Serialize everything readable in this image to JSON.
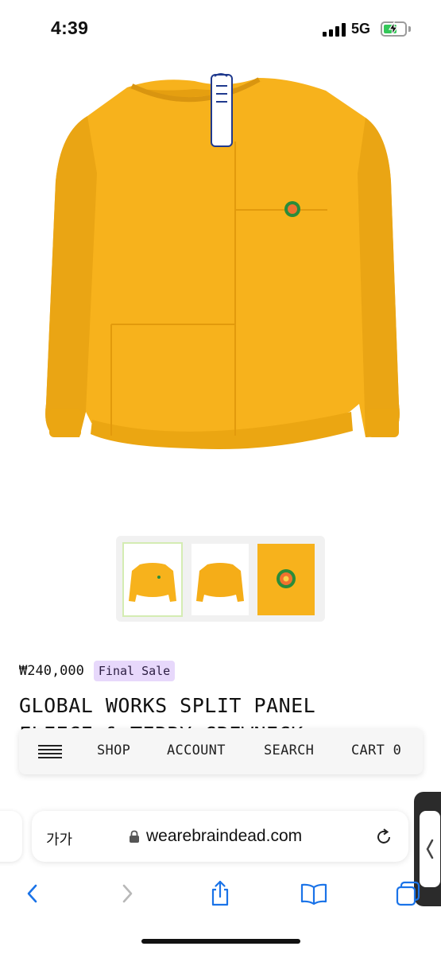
{
  "status_bar": {
    "time": "4:39",
    "network": "5G",
    "battery_charging": true,
    "battery_level": 0.55
  },
  "product": {
    "image_icon": "yellow-sweatshirt-image",
    "thumbnails": [
      {
        "name": "front",
        "active": true
      },
      {
        "name": "back",
        "active": false
      },
      {
        "name": "patch-detail",
        "active": false
      }
    ],
    "price": "₩240,000",
    "badge": "Final Sale",
    "title_line1": "GLOBAL WORKS SPLIT PANEL",
    "title_line2": "FLEECE & TERRY CREWNECK"
  },
  "nav": {
    "menu_icon": "hamburger-icon",
    "shop": "SHOP",
    "account": "ACCOUNT",
    "search": "SEARCH",
    "cart": "CART 0"
  },
  "safari": {
    "aa_label": "가가",
    "url": "wearebraindead.com",
    "lock_icon": "lock-icon",
    "reload_icon": "reload-icon"
  },
  "toolbar": {
    "icons": [
      "back-icon",
      "forward-icon",
      "share-icon",
      "bookmarks-icon",
      "tabs-icon"
    ]
  },
  "colors": {
    "sweatshirt": "#f7b21c",
    "badge_bg": "#e7d8fb",
    "safari_blue": "#1a73e8",
    "battery_green": "#34c759"
  }
}
